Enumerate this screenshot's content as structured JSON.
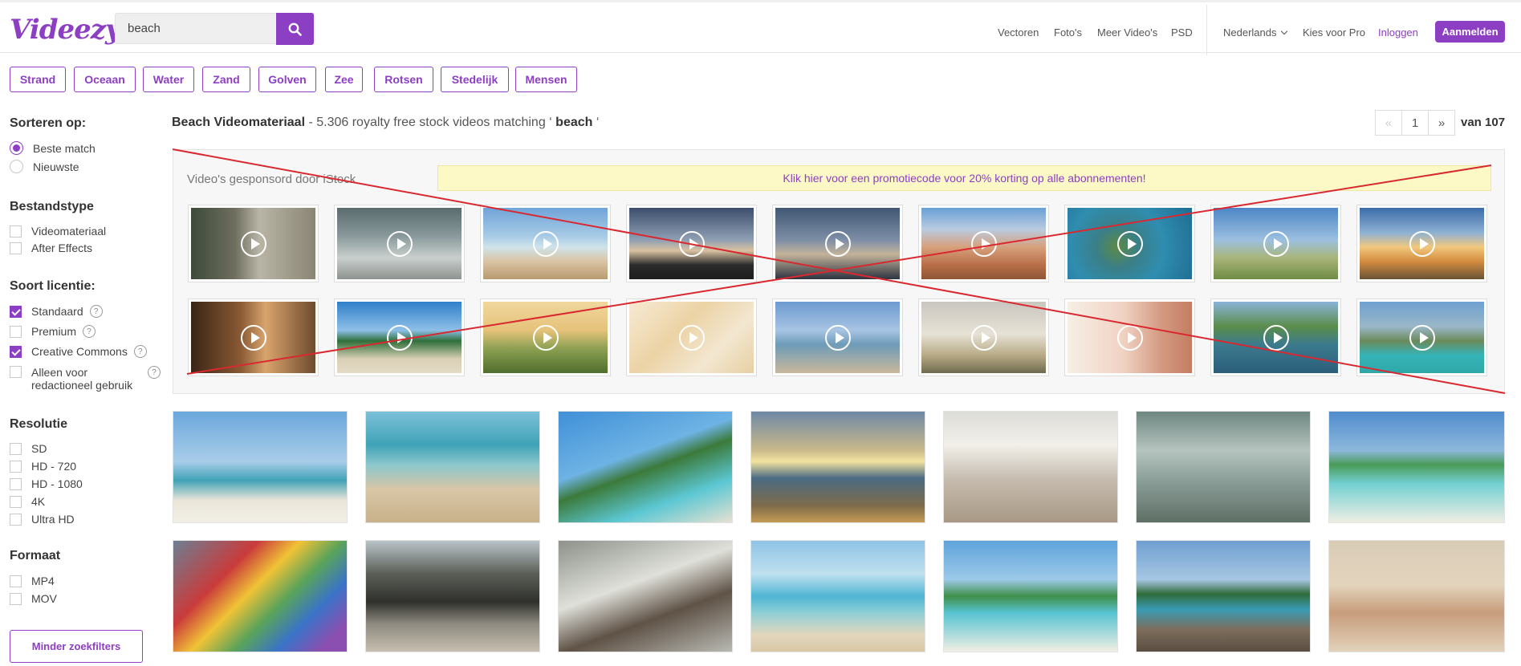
{
  "header": {
    "logo": "Videezy",
    "search_value": "beach",
    "nav": [
      "Vectoren",
      "Foto's",
      "Meer Video's",
      "PSD"
    ],
    "language": "Nederlands",
    "pro": "Kies voor Pro",
    "login": "Inloggen",
    "signup": "Aanmelden"
  },
  "tags": [
    "Strand",
    "Oceaan",
    "Water",
    "Zand",
    "Golven",
    "Zee",
    "Rotsen",
    "Stedelijk",
    "Mensen"
  ],
  "sidebar": {
    "sort_title": "Sorteren op:",
    "sort_options": [
      {
        "label": "Beste match",
        "checked": true
      },
      {
        "label": "Nieuwste",
        "checked": false
      }
    ],
    "filetype_title": "Bestandstype",
    "filetype_options": [
      "Videomateriaal",
      "After Effects"
    ],
    "license_title": "Soort licentie:",
    "license_options": [
      {
        "label": "Standaard",
        "checked": true
      },
      {
        "label": "Premium",
        "checked": false
      },
      {
        "label": "Creative Commons",
        "checked": true
      },
      {
        "label": "Alleen voor redactioneel gebruik",
        "line1": "Alleen voor",
        "line2": "redactioneel gebruik",
        "checked": false
      }
    ],
    "help_glyph": "?",
    "resolution_title": "Resolutie",
    "resolution_options": [
      "SD",
      "HD - 720",
      "HD - 1080",
      "4K",
      "Ultra HD"
    ],
    "format_title": "Formaat",
    "format_options": [
      "MP4",
      "MOV"
    ],
    "less_filters": "Minder zoekfilters"
  },
  "results": {
    "title": "Beach Videomateriaal",
    "subtitle": " - 5.306 royalty free stock videos matching ‘",
    "query": " beach ",
    "quote_close": "‘",
    "prev": "«",
    "page": "1",
    "next": "»",
    "total": "van 107"
  },
  "sponsored": {
    "label": "Video's gesponsord door iStock",
    "promo": "Klik hier voor een promotiecode voor 20% korting op alle abonnementen!"
  },
  "colors": {
    "accent": "#8d3fc3",
    "promo_bg": "#fcf9c6",
    "cross_line": "#d9282f"
  }
}
